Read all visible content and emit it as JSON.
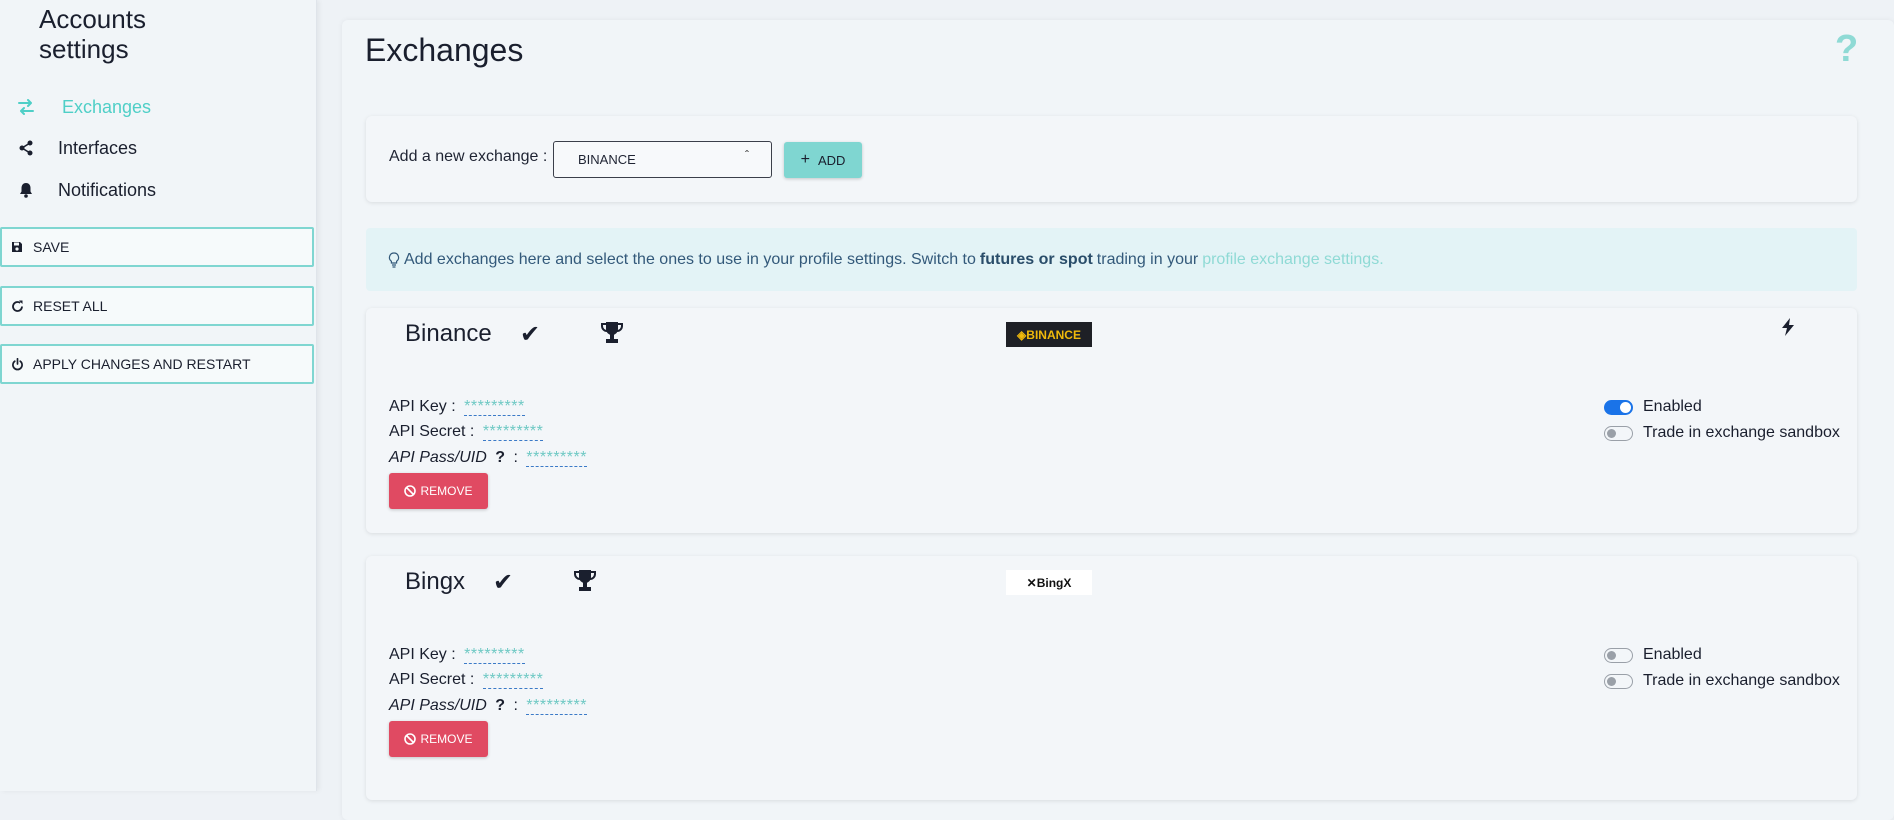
{
  "sidebar": {
    "title_line1": "Accounts",
    "title_line2": "settings",
    "nav": [
      {
        "label": "Exchanges",
        "icon": "arrows-exchange-icon",
        "active": true
      },
      {
        "label": "Interfaces",
        "icon": "share-nodes-icon",
        "active": false
      },
      {
        "label": "Notifications",
        "icon": "bell-icon",
        "active": false
      }
    ],
    "buttons": {
      "save": "SAVE",
      "reset_all": "RESET ALL",
      "apply_restart": "APPLY CHANGES AND RESTART"
    }
  },
  "main": {
    "title": "Exchanges",
    "help": "?",
    "add_exchange": {
      "label": "Add a new exchange :",
      "selected": "BINANCE",
      "add_label": "ADD"
    },
    "info": {
      "text_before": "Add exchanges here and select the ones to use in your profile settings. Switch to",
      "bold": "futures or spot",
      "text_after": "trading in your",
      "link": "profile exchange settings."
    },
    "exchanges": [
      {
        "name": "Binance",
        "logo_text": "◈BINANCE",
        "api_key_label": "API Key :",
        "api_key_value": "*********",
        "api_secret_label": "API Secret :",
        "api_secret_value": "*********",
        "api_pass_label": "API Pass/UID",
        "api_pass_q": "?",
        "api_pass_sep": ":",
        "api_pass_value": "*********",
        "remove_label": "REMOVE",
        "enabled_label": "Enabled",
        "enabled": true,
        "sandbox_label": "Trade in exchange sandbox",
        "sandbox": false
      },
      {
        "name": "Bingx",
        "logo_text": "✕BingX",
        "api_key_label": "API Key :",
        "api_key_value": "*********",
        "api_secret_label": "API Secret :",
        "api_secret_value": "*********",
        "api_pass_label": "API Pass/UID",
        "api_pass_q": "?",
        "api_pass_sep": ":",
        "api_pass_value": "*********",
        "remove_label": "REMOVE",
        "enabled_label": "Enabled",
        "enabled": false,
        "sandbox_label": "Trade in exchange sandbox",
        "sandbox": false
      }
    ]
  },
  "colors": {
    "accent": "#4fcfc7",
    "danger": "#e04a62",
    "toggle_on": "#1a73e8"
  }
}
